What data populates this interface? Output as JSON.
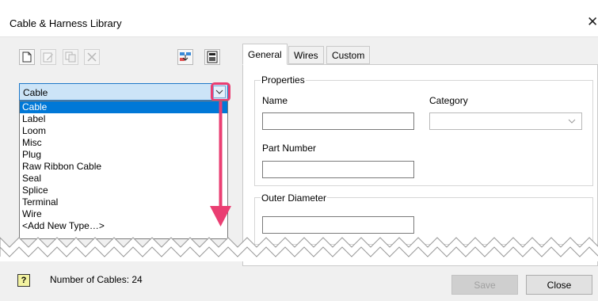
{
  "window": {
    "title": "Cable & Harness Library",
    "close_glyph": "✕"
  },
  "toolbar": {
    "buttons": [
      {
        "name": "new-icon",
        "enabled": true
      },
      {
        "name": "edit-icon",
        "enabled": false
      },
      {
        "name": "copy-icon",
        "enabled": false
      },
      {
        "name": "delete-icon",
        "enabled": false
      },
      {
        "name": "import-icon",
        "enabled": true
      },
      {
        "name": "export-icon",
        "enabled": true
      }
    ]
  },
  "type_selector": {
    "value": "Cable",
    "options": [
      "Cable",
      "Label",
      "Loom",
      "Misc",
      "Plug",
      "Raw Ribbon Cable",
      "Seal",
      "Splice",
      "Terminal",
      "Wire",
      "<Add New Type…>"
    ],
    "selected_index": 0
  },
  "tabs": [
    {
      "label": "General",
      "active": true
    },
    {
      "label": "Wires",
      "active": false
    },
    {
      "label": "Custom",
      "active": false
    }
  ],
  "general": {
    "properties_legend": "Properties",
    "name_label": "Name",
    "name_value": "",
    "category_label": "Category",
    "category_value": "",
    "part_number_label": "Part Number",
    "part_number_value": "",
    "outer_diameter_legend": "Outer Diameter",
    "outer_diameter_value": ""
  },
  "footer": {
    "help_label": "?",
    "status": "Number of Cables: 24",
    "save_label": "Save",
    "save_enabled": false,
    "close_label": "Close"
  },
  "colors": {
    "highlight": "#ea3e72",
    "selection": "#0078d7"
  }
}
